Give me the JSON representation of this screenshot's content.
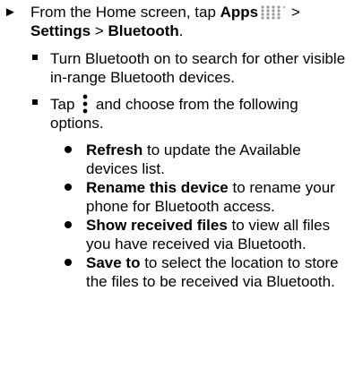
{
  "step": {
    "marker": "►",
    "intro": "From the Home screen, tap ",
    "apps_label": "Apps",
    "apps_icon": "apps-grid-icon",
    "sep1": " > ",
    "settings_label": "Settings",
    "sep2": " > ",
    "bluetooth_label": "Bluetooth",
    "end": "."
  },
  "sub_items": [
    {
      "text": "Turn Bluetooth on to search for other visible in-range Bluetooth devices."
    },
    {
      "text_before": "Tap ",
      "icon": "menu-kebab-icon",
      "text_after": " and choose from the following options."
    }
  ],
  "options": [
    {
      "bold": "Refresh",
      "text": " to update the Available devices list."
    },
    {
      "bold": "Rename this device",
      "text": " to rename your phone for Bluetooth access."
    },
    {
      "bold": "Show received files",
      "text": " to view all files you have received via Bluetooth."
    },
    {
      "bold": "Save to",
      "text": " to select the location to store the files to be received via Bluetooth."
    }
  ]
}
